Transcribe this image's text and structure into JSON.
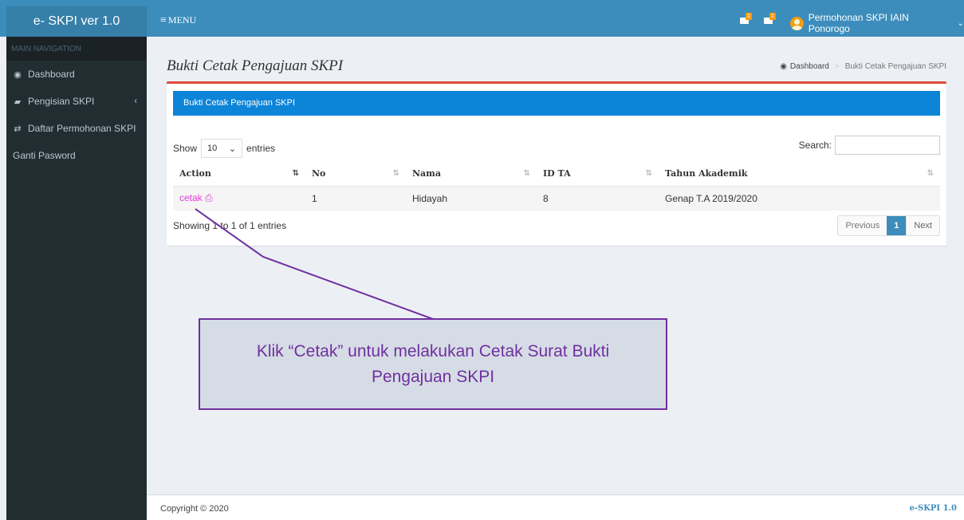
{
  "header": {
    "logo": "e- SKPI ver 1.0",
    "menu_label": "MENU",
    "user_name": "Permohonan SKPI IAIN Ponorogo",
    "notif_badge_1": "1",
    "notif_badge_2": "1"
  },
  "sidebar": {
    "heading": "MAIN NAVIGATION",
    "items": [
      {
        "label": "Dashboard",
        "icon": "dashboard-icon"
      },
      {
        "label": "Pengisian SKPI",
        "icon": "book-icon"
      },
      {
        "label": "Daftar Permohonan SKPI",
        "icon": "exchange-icon"
      },
      {
        "label": "Ganti Pasword",
        "icon": ""
      }
    ]
  },
  "content": {
    "title": "Bukti Cetak Pengajuan SKPI",
    "breadcrumb": {
      "home": "Dashboard",
      "current": "Bukti Cetak Pengajuan SKPI"
    }
  },
  "box": {
    "title": "Bukti Cetak Pengajuan SKPI",
    "show_label": "Show",
    "length_value": "10",
    "entries_label": "entries",
    "search_label": "Search:",
    "search_value": "",
    "columns": [
      "Action",
      "No",
      "Nama",
      "ID TA",
      "Tahun Akademik"
    ],
    "rows": [
      {
        "action": "cetak",
        "no": "1",
        "nama": "Hidayah",
        "id_ta": "8",
        "tahun": "Genap T.A 2019/2020"
      }
    ],
    "info": "Showing 1 to 1 of 1 entries",
    "pager": {
      "prev": "Previous",
      "current": "1",
      "next": "Next"
    }
  },
  "annotation": {
    "text": "Klik “Cetak” untuk melakukan Cetak Surat Bukti Pengajuan SKPI"
  },
  "footer": {
    "copyright": "Copyright © 2020",
    "version": "e-SKPI 1.0"
  },
  "colors": {
    "header": "#3c8dbc",
    "sidebar": "#222d32",
    "box_header": "#0c84d8",
    "link": "#e23bd8",
    "annotation_border": "#7030a0",
    "annotation_fill": "#d6dce5"
  }
}
